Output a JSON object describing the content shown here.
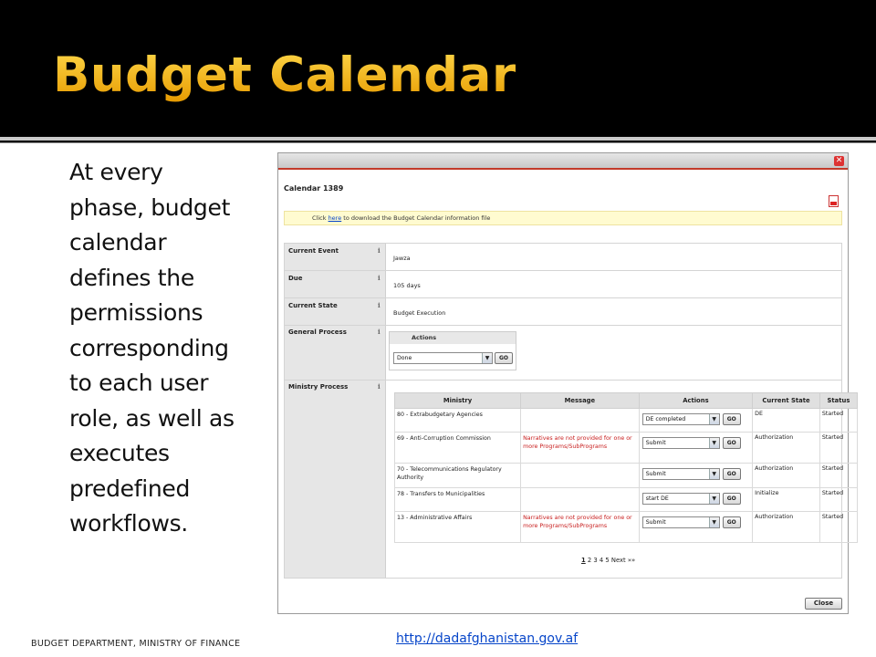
{
  "slide": {
    "title": "Budget Calendar",
    "body_lines": [
      "At every",
      "phase, budget",
      "calendar",
      "defines the",
      "permissions",
      "corresponding",
      "to each user",
      "role, as well as",
      "executes",
      "predefined",
      "workflows."
    ],
    "footer_left": "BUDGET DEPARTMENT, MINISTRY OF FINANCE",
    "footer_link": "http://dadafghanistan.gov.af",
    "title_color": "#f0b000"
  },
  "window": {
    "close_icon": "close-icon",
    "calendar_title": "Calendar 1389",
    "pdf_icon": "pdf-icon",
    "notice": {
      "prefix": "Click ",
      "link": "here",
      "suffix": " to download the Budget Calendar information file"
    },
    "fields": {
      "current_event": {
        "label": "Current Event",
        "value": "Jawza"
      },
      "due": {
        "label": "Due",
        "value": "105 days"
      },
      "current_state": {
        "label": "Current State",
        "value": "Budget Execution"
      },
      "general_process": {
        "label": "General Process"
      },
      "ministry_process": {
        "label": "Ministry Process"
      }
    },
    "info_glyph": "i",
    "general_actions": {
      "header": "Actions",
      "selected": "Done",
      "go": "GO"
    },
    "ministry_table": {
      "headers": [
        "Ministry",
        "Message",
        "Actions",
        "Current State",
        "Status"
      ],
      "rows": [
        {
          "ministry": "80 - Extrabudgetary Agencies",
          "message": "",
          "action": "DE completed",
          "state": "DE",
          "status": "Started"
        },
        {
          "ministry": "69 - Anti-Corruption Commission",
          "message": "Narratives are not provided for one or more Programs/SubPrograms",
          "action": "Submit",
          "state": "Authorization",
          "status": "Started"
        },
        {
          "ministry": "70 - Telecommunications Regulatory Authority",
          "message": "",
          "action": "Submit",
          "state": "Authorization",
          "status": "Started"
        },
        {
          "ministry": "78 - Transfers to Municipalities",
          "message": "",
          "action": "start DE",
          "state": "Initialize",
          "status": "Started"
        },
        {
          "ministry": "13 - Administrative Affairs",
          "message": "Narratives are not provided for one or more Programs/SubPrograms",
          "action": "Submit",
          "state": "Authorization",
          "status": "Started"
        }
      ],
      "go": "GO"
    },
    "pager": {
      "current": "1",
      "pages": "2 3 4 5",
      "next": "Next »»"
    },
    "close_button": "Close",
    "accent_color": "#c23a2a"
  }
}
